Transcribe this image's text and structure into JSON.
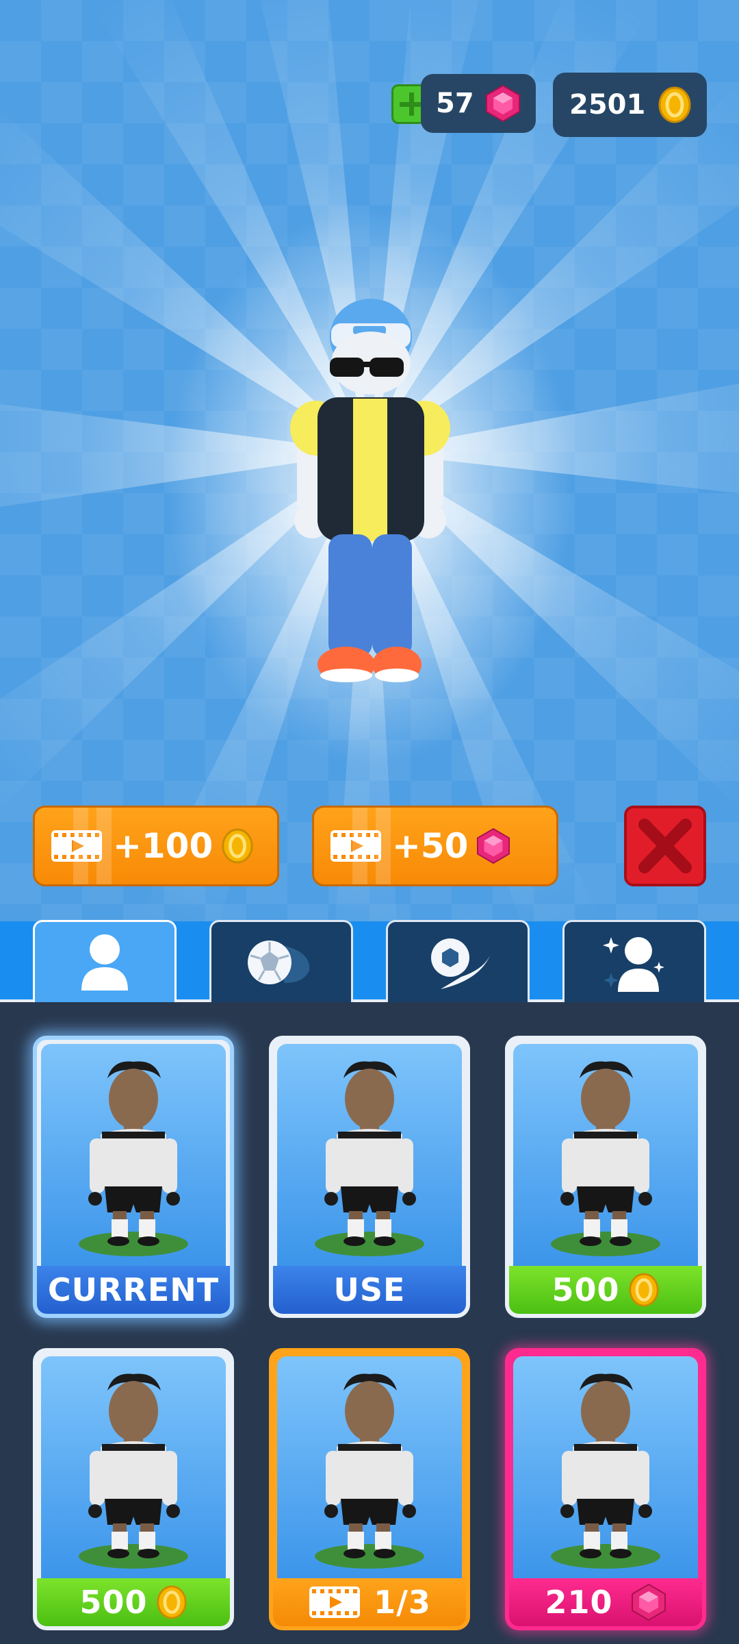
{
  "currency": {
    "gems": "57",
    "coins": "2501"
  },
  "rewards": {
    "coins_label": "+100",
    "gems_label": "+50"
  },
  "tabs": [
    {
      "name": "character",
      "active": true
    },
    {
      "name": "ball",
      "active": false
    },
    {
      "name": "trail",
      "active": false
    },
    {
      "name": "emote",
      "active": false
    }
  ],
  "cards": [
    {
      "label": "CURRENT",
      "style": "blue",
      "icon": "none"
    },
    {
      "label": "USE",
      "style": "blue",
      "icon": "none"
    },
    {
      "label": "500",
      "style": "green",
      "icon": "coin-icon"
    },
    {
      "label": "500",
      "style": "green",
      "icon": "coin-icon"
    },
    {
      "label": "1/3",
      "style": "orange",
      "icon": "video-icon"
    },
    {
      "label": "210",
      "style": "pink",
      "icon": "gem-icon"
    }
  ],
  "colors": {
    "background": "#4f9fe4",
    "panel": "#28384f",
    "orange": "#f88a06",
    "close_red": "#e21d2a",
    "gem_pink": "#e8277a",
    "coin_gold": "#f6b400"
  }
}
